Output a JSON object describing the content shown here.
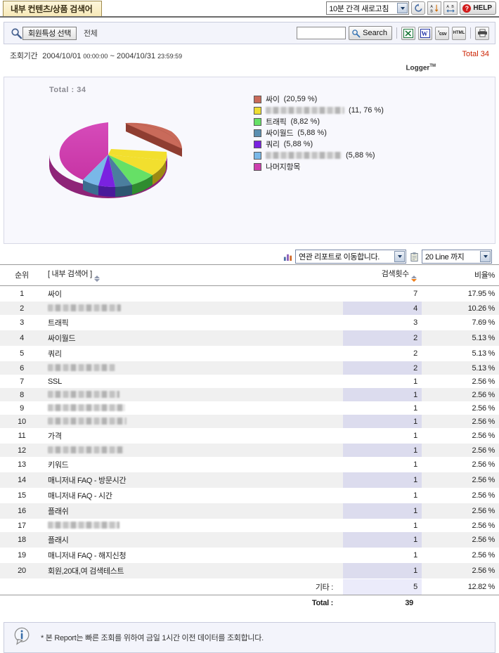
{
  "titlebar": {
    "tab_label": "내부 컨텐츠/상품 검색어",
    "refresh_interval": "10분 간격 새로고침",
    "refresh_icon": "refresh-icon",
    "sort_numeric_icon": "sort-numeric-icon",
    "sort_alpha_icon": "sort-alpha-icon",
    "help_label": "HELP",
    "help_mark": "?"
  },
  "searchbar": {
    "magnifier_icon": "magnifier-icon",
    "member_filter_button": "회원특성 선택",
    "member_filter_value": "전체",
    "search_input_value": "",
    "search_input_placeholder": "",
    "search_button": "Search",
    "export_excel": "X",
    "export_word": "W",
    "export_csv": "csv",
    "export_html": "HTML",
    "print_icon": "printer-icon"
  },
  "period": {
    "label": "조회기간",
    "start_date": "2004/10/01",
    "start_time": "00:00:00",
    "separator": "~",
    "end_date": "2004/10/31",
    "end_time": "23:59:59",
    "total_text": "Total 34",
    "logger_brand": "Logger",
    "logger_tm": "TM"
  },
  "chart_data": {
    "type": "pie",
    "title": "Total : 34",
    "total": 34,
    "exploded_index": 0,
    "legend_position": "right",
    "categories": [
      "싸이",
      "[redacted]",
      "트래픽",
      "싸이월드",
      "쿼리",
      "[redacted]",
      "나머지항목"
    ],
    "labels": [
      "싸이  (20,59 %)",
      "(11, 76 %)",
      "트래픽  (8,82 %)",
      "싸이월드  (5,88 %)",
      "쿼리  (5,88 %)",
      "(5,88 %)",
      "나머지항목"
    ],
    "values": [
      20.59,
      11.76,
      8.82,
      5.88,
      5.88,
      5.88,
      41.19
    ],
    "colors": [
      "#c96a5a",
      "#eedd33",
      "#66e066",
      "#5b8fb0",
      "#7a22e0",
      "#79b8e8",
      "#cc3fae"
    ],
    "redacted_flags": [
      false,
      true,
      false,
      false,
      false,
      true,
      false
    ],
    "legend": [
      {
        "label": "싸이",
        "pct": "(20,59 %)",
        "color": "#c96a5a",
        "redacted": false
      },
      {
        "label": "",
        "pct": "(11, 76 %)",
        "color": "#eedd33",
        "redacted": true
      },
      {
        "label": "트래픽",
        "pct": "(8,82 %)",
        "color": "#66e066",
        "redacted": false
      },
      {
        "label": "싸이월드",
        "pct": "(5,88 %)",
        "color": "#5b8fb0",
        "redacted": false
      },
      {
        "label": "쿼리",
        "pct": "(5,88 %)",
        "color": "#7a22e0",
        "redacted": false
      },
      {
        "label": "",
        "pct": "(5,88 %)",
        "color": "#79b8e8",
        "redacted": true
      },
      {
        "label": "나머지항목",
        "pct": "",
        "color": "#cc3fae",
        "redacted": false
      }
    ]
  },
  "navrow": {
    "chart_icon": "bar-chart-icon",
    "related_report": "연관 리포트로 이동합니다.",
    "list_icon": "clipboard-icon",
    "line_limit": "20 Line 까지"
  },
  "table": {
    "headers": {
      "rank": "순위",
      "term": "[ 내부 검색어 ]",
      "count": "검색횟수",
      "ratio": "비율%"
    },
    "rows": [
      {
        "rank": "1",
        "term": "싸이",
        "redacted": false,
        "count": "7",
        "ratio": "17.95 %"
      },
      {
        "rank": "2",
        "term": "",
        "redacted": true,
        "count": "4",
        "ratio": "10.26 %"
      },
      {
        "rank": "3",
        "term": "트래픽",
        "redacted": false,
        "count": "3",
        "ratio": "7.69 %"
      },
      {
        "rank": "4",
        "term": "싸이월드",
        "redacted": false,
        "count": "2",
        "ratio": "5.13 %"
      },
      {
        "rank": "5",
        "term": "쿼리",
        "redacted": false,
        "count": "2",
        "ratio": "5.13 %"
      },
      {
        "rank": "6",
        "term": "",
        "redacted": true,
        "count": "2",
        "ratio": "5.13 %"
      },
      {
        "rank": "7",
        "term": "SSL",
        "redacted": false,
        "count": "1",
        "ratio": "2.56 %"
      },
      {
        "rank": "8",
        "term": "",
        "redacted": true,
        "count": "1",
        "ratio": "2.56 %"
      },
      {
        "rank": "9",
        "term": "",
        "redacted": true,
        "count": "1",
        "ratio": "2.56 %"
      },
      {
        "rank": "10",
        "term": "",
        "redacted": true,
        "count": "1",
        "ratio": "2.56 %"
      },
      {
        "rank": "11",
        "term": "가격",
        "redacted": false,
        "count": "1",
        "ratio": "2.56 %"
      },
      {
        "rank": "12",
        "term": "",
        "redacted": true,
        "count": "1",
        "ratio": "2.56 %"
      },
      {
        "rank": "13",
        "term": "키워드",
        "redacted": false,
        "count": "1",
        "ratio": "2.56 %"
      },
      {
        "rank": "14",
        "term": "매니저내 FAQ - 방문시간",
        "redacted": false,
        "count": "1",
        "ratio": "2.56 %"
      },
      {
        "rank": "15",
        "term": "매니저내 FAQ - 시간",
        "redacted": false,
        "count": "1",
        "ratio": "2.56 %"
      },
      {
        "rank": "16",
        "term": "플래쉬",
        "redacted": false,
        "count": "1",
        "ratio": "2.56 %"
      },
      {
        "rank": "17",
        "term": "",
        "redacted": true,
        "count": "1",
        "ratio": "2.56 %"
      },
      {
        "rank": "18",
        "term": "플래시",
        "redacted": false,
        "count": "1",
        "ratio": "2.56 %"
      },
      {
        "rank": "19",
        "term": "매니저내 FAQ - 해지신청",
        "redacted": false,
        "count": "1",
        "ratio": "2.56 %"
      },
      {
        "rank": "20",
        "term": "회원,20대,여 검색테스트",
        "redacted": false,
        "count": "1",
        "ratio": "2.56 %"
      }
    ],
    "etc_label": "기타 :",
    "etc_count": "5",
    "etc_ratio": "12.82 %",
    "total_label": "Total :",
    "total_count": "39"
  },
  "notice": {
    "info_icon": "info-icon",
    "text": "* 본 Report는 빠른 조회를 위하여 금일 1시간 이전 데이터를 조회합니다."
  }
}
